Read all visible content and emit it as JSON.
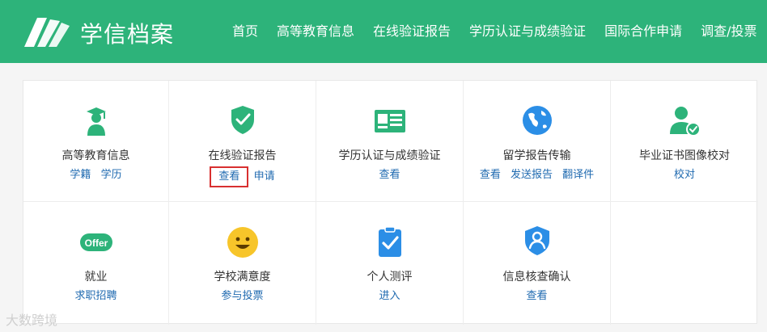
{
  "brand": {
    "name": "学信档案"
  },
  "nav": [
    "首页",
    "高等教育信息",
    "在线验证报告",
    "学历认证与成绩验证",
    "国际合作申请",
    "调查/投票"
  ],
  "services_row1": [
    {
      "title": "高等教育信息",
      "links": [
        "学籍",
        "学历"
      ],
      "icon": "graduate-icon"
    },
    {
      "title": "在线验证报告",
      "links": [
        "查看",
        "申请"
      ],
      "icon": "shield-check-icon"
    },
    {
      "title": "学历认证与成绩验证",
      "links": [
        "查看"
      ],
      "icon": "certificate-card-icon"
    },
    {
      "title": "留学报告传输",
      "links": [
        "查看",
        "发送报告",
        "翻译件"
      ],
      "icon": "globe-icon"
    },
    {
      "title": "毕业证书图像校对",
      "links": [
        "校对"
      ],
      "icon": "user-verified-icon"
    }
  ],
  "services_row2": [
    {
      "title": "就业",
      "links": [
        "求职招聘"
      ],
      "icon": "offer-icon",
      "badge": "Offer"
    },
    {
      "title": "学校满意度",
      "links": [
        "参与投票"
      ],
      "icon": "smiley-icon"
    },
    {
      "title": "个人测评",
      "links": [
        "进入"
      ],
      "icon": "clipboard-check-icon"
    },
    {
      "title": "信息核查确认",
      "links": [
        "查看"
      ],
      "icon": "user-shield-icon"
    }
  ],
  "colors": {
    "brand_green": "#2db37a",
    "link_blue": "#1f6ab0",
    "icon_blue": "#2b8ee6",
    "icon_yellow": "#f7c52a",
    "highlight_red": "#d83030"
  },
  "watermark": "大数跨境"
}
